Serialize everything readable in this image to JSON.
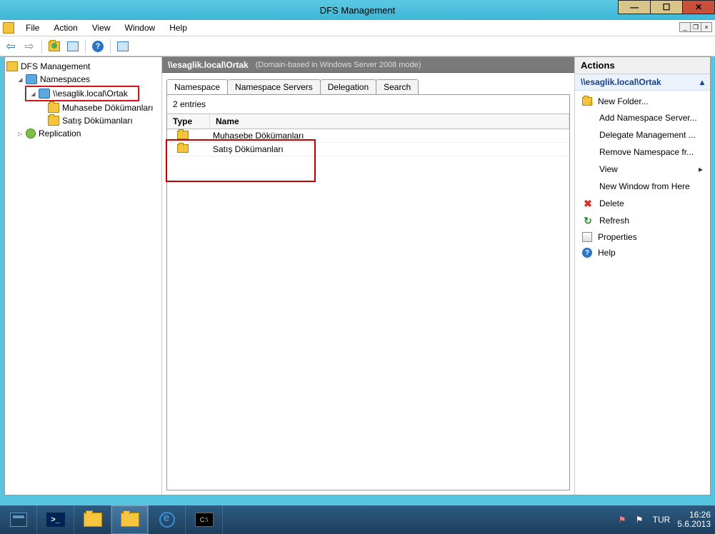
{
  "window": {
    "title": "DFS Management"
  },
  "menu": {
    "file": "File",
    "action": "Action",
    "view": "View",
    "window": "Window",
    "help": "Help"
  },
  "tree": {
    "root": "DFS Management",
    "namespaces": "Namespaces",
    "selected_path": "\\\\esaglik.local\\Ortak",
    "folder1": "Muhasebe Dökümanları",
    "folder2": "Satış Dökümanları",
    "replication": "Replication"
  },
  "center": {
    "title": "\\\\esaglik.local\\Ortak",
    "subtitle": "(Domain-based in Windows Server 2008 mode)",
    "tabs": {
      "namespace": "Namespace",
      "servers": "Namespace Servers",
      "delegation": "Delegation",
      "search": "Search"
    },
    "entries_label": "2 entries",
    "col_type": "Type",
    "col_name": "Name",
    "rows": [
      {
        "name": "Muhasebe Dökümanları"
      },
      {
        "name": "Satış Dökümanları"
      }
    ]
  },
  "actions": {
    "pane_title": "Actions",
    "section_title": "\\\\esaglik.local\\Ortak",
    "items": {
      "new_folder": "New Folder...",
      "add_server": "Add Namespace Server...",
      "delegate": "Delegate Management ...",
      "remove": "Remove Namespace fr...",
      "view": "View",
      "new_window": "New Window from Here",
      "delete": "Delete",
      "refresh": "Refresh",
      "properties": "Properties",
      "help": "Help"
    }
  },
  "taskbar": {
    "lang": "TUR",
    "time": "16:26",
    "date": "5.6.2013"
  }
}
